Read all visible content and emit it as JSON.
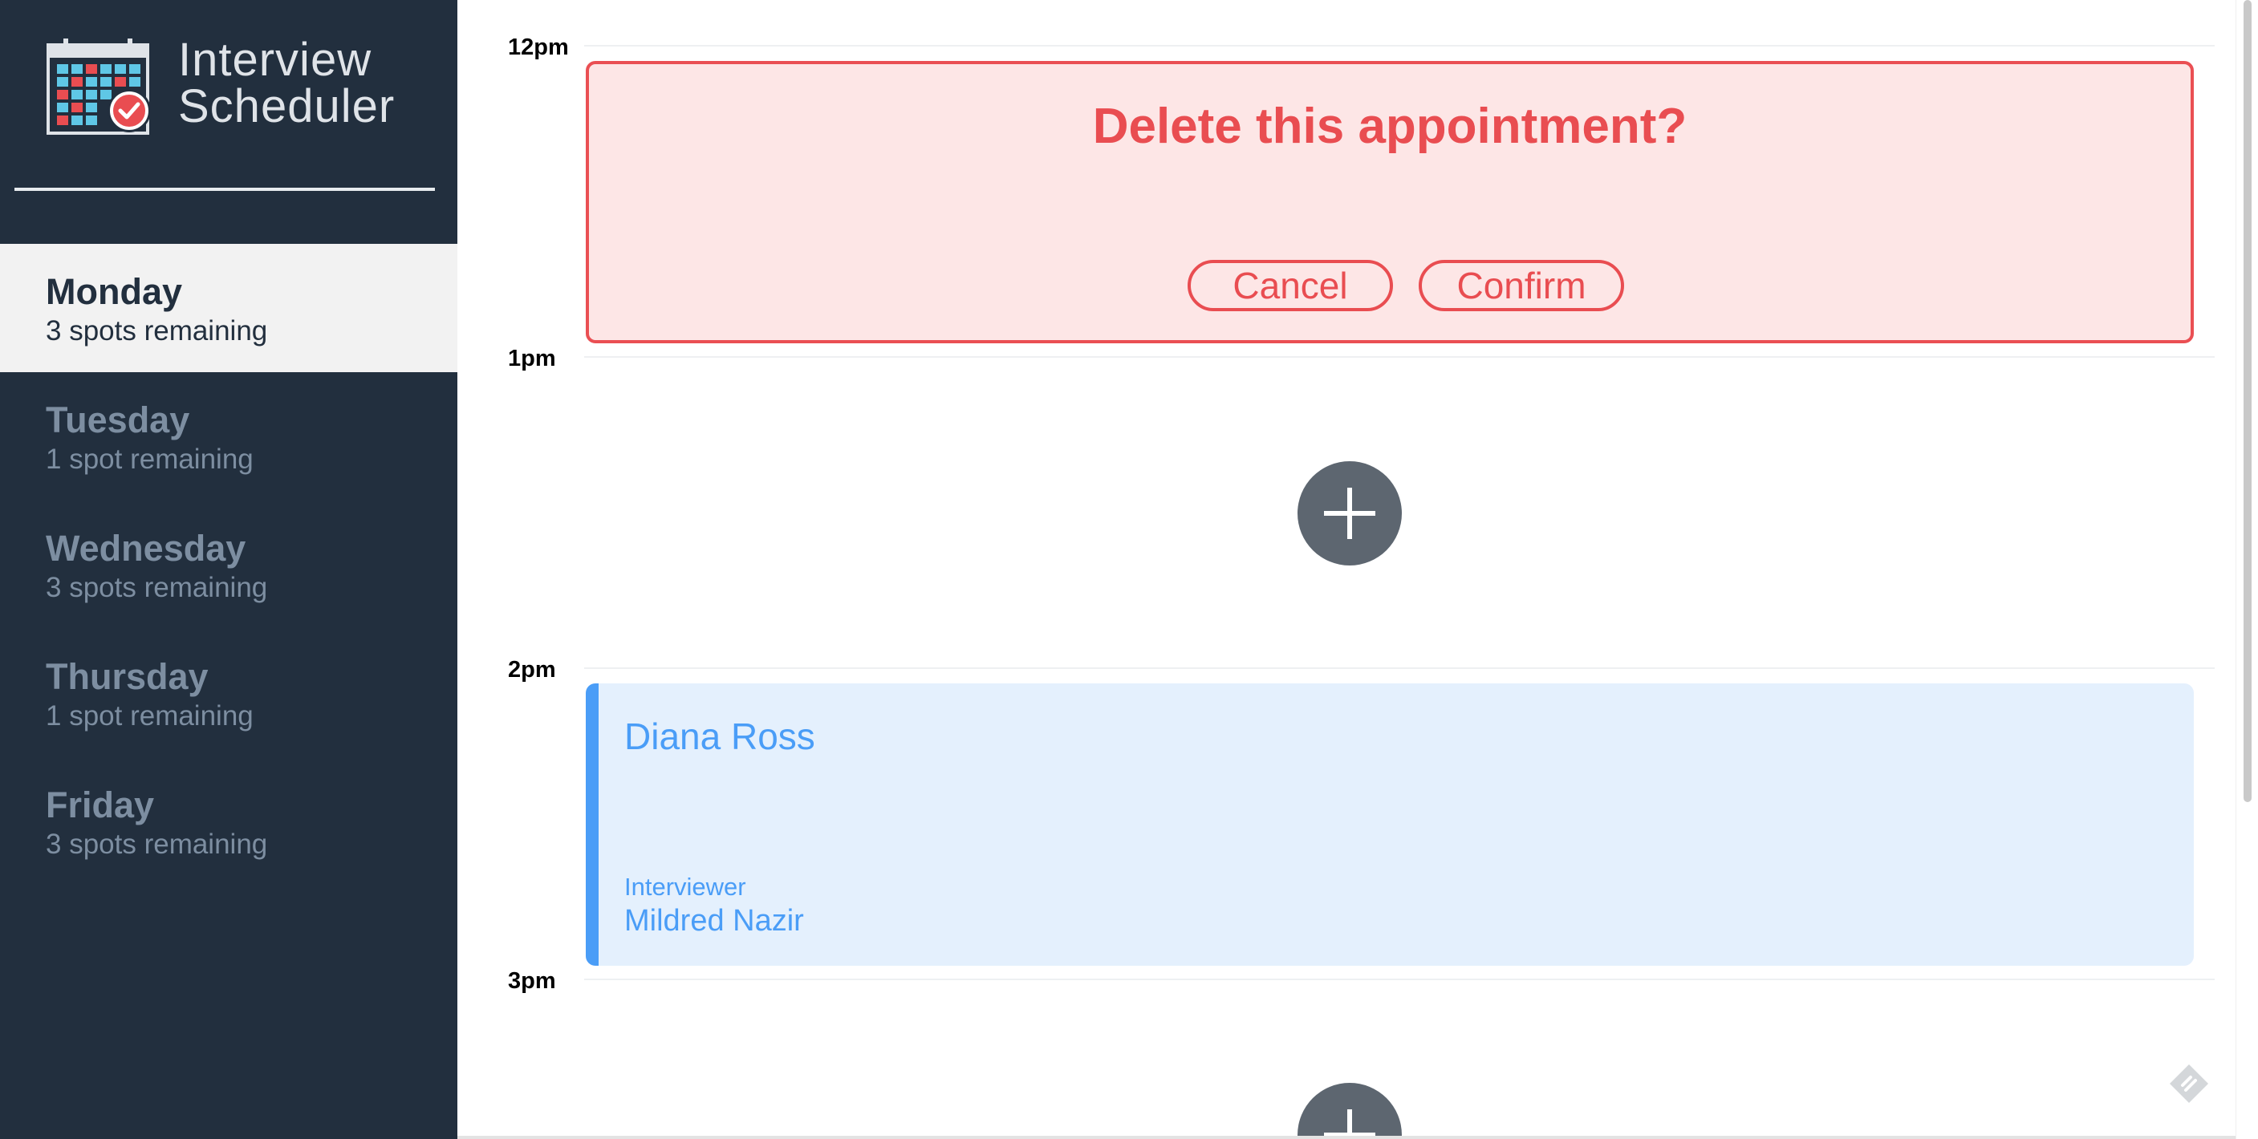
{
  "brand": {
    "line1": "Interview",
    "line2": "Scheduler",
    "logo_icon": "calendar-check-icon"
  },
  "days": [
    {
      "name": "Monday",
      "spots": "3 spots remaining",
      "selected": true
    },
    {
      "name": "Tuesday",
      "spots": "1 spot remaining",
      "selected": false
    },
    {
      "name": "Wednesday",
      "spots": "3 spots remaining",
      "selected": false
    },
    {
      "name": "Thursday",
      "spots": "1 spot remaining",
      "selected": false
    },
    {
      "name": "Friday",
      "spots": "3 spots remaining",
      "selected": false
    }
  ],
  "schedule": {
    "times": [
      "12pm",
      "1pm",
      "2pm",
      "3pm"
    ],
    "confirm": {
      "message": "Delete this appointment?",
      "cancel_label": "Cancel",
      "confirm_label": "Confirm"
    },
    "appointment": {
      "student": "Diana Ross",
      "role_label": "Interviewer",
      "interviewer": "Mildred Nazir"
    },
    "add_icon": "plus-icon"
  },
  "colors": {
    "sidebar_bg": "#222f3e",
    "danger": "#e94d51",
    "danger_bg": "#fde6e6",
    "accent_blue": "#4a9df7",
    "appointment_bg": "#e4f0fd",
    "add_button": "#5d6670"
  }
}
